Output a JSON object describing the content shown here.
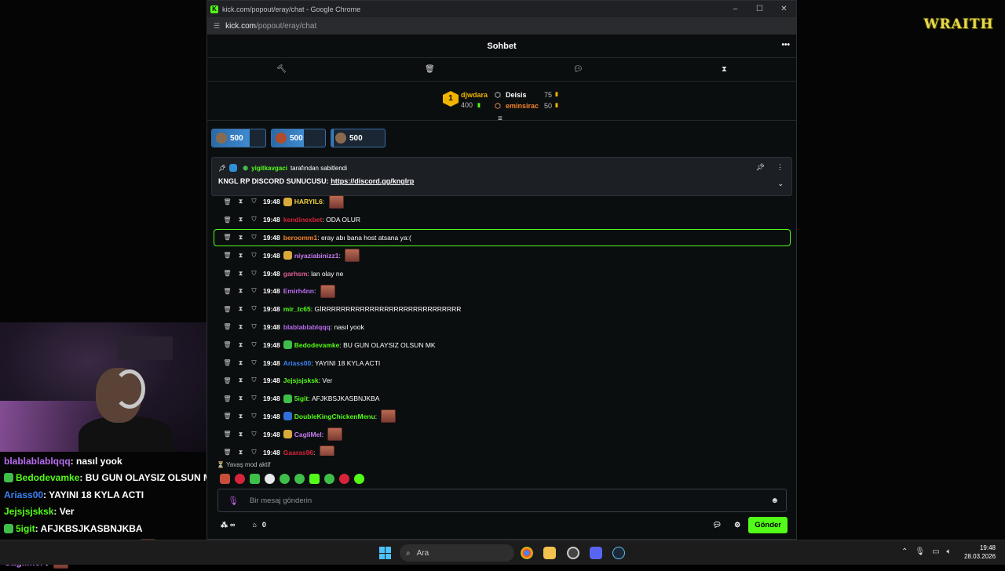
{
  "browser": {
    "window_title": "kick.com/popout/eray/chat - Google Chrome",
    "url_host": "kick.com",
    "url_path": "/popout/eray/chat"
  },
  "chat": {
    "title": "Sohbet",
    "leaderboard": {
      "first": {
        "rank": "1",
        "name": "djwdara",
        "amount": "400"
      },
      "second": {
        "name": "Deisis",
        "amount": "75"
      },
      "third": {
        "name": "eminsirac",
        "amount": "50"
      }
    },
    "gifts": [
      {
        "amount": "500",
        "fill": 0.7
      },
      {
        "amount": "500",
        "fill": 0.6
      },
      {
        "amount": "500",
        "fill": 0.05
      }
    ],
    "pinned": {
      "pinned_by_user": "yigitkavgaci",
      "pinned_by_suffix": "tarafından sabitlendi",
      "message_prefix": "KNGL RP DISCORD SUNUCUSU:",
      "message_link": "https://discord.gg/knglrp"
    },
    "messages": [
      {
        "time": "19:48",
        "user": "HARYIL6",
        "color": "#f2d33a",
        "text": "",
        "emote": true,
        "badge": "#d9a93b"
      },
      {
        "time": "19:48",
        "user": "kendinexbet",
        "color": "#d8243a",
        "text": "ODA OLUR",
        "emote": false,
        "badge": ""
      },
      {
        "time": "19:48",
        "user": "beroomm1",
        "color": "#f2822a",
        "text": "eray abı bana host atsana ya:(",
        "emote": false,
        "badge": "",
        "highlight": true
      },
      {
        "time": "19:48",
        "user": "niyaziabinizz1",
        "color": "#c97bf2",
        "text": "",
        "emote": true,
        "badge": "#d9a93b"
      },
      {
        "time": "19:48",
        "user": "garhsm",
        "color": "#e05d9a",
        "text": "lan olay ne",
        "emote": false,
        "badge": ""
      },
      {
        "time": "19:48",
        "user": "Emirh4nn",
        "color": "#b76cf0",
        "text": "",
        "emote": true,
        "badge": ""
      },
      {
        "time": "19:48",
        "user": "mir_tc65",
        "color": "#53fc18",
        "text": "GİRRRRRRRRRRRRRRRRRRRRRRRRRRRRR",
        "emote": false,
        "badge": ""
      },
      {
        "time": "19:48",
        "user": "blablablablqqq",
        "color": "#b76cf0",
        "text": "nasıl yook",
        "emote": false,
        "badge": ""
      },
      {
        "time": "19:48",
        "user": "Bedodevamke",
        "color": "#53fc18",
        "text": "BU GUN OLAYSIZ OLSUN MK",
        "emote": false,
        "badge": "#3fbf4a"
      },
      {
        "time": "19:48",
        "user": "Ariass00",
        "color": "#3b82f6",
        "text": "YAYINI 18 KYLA ACTI",
        "emote": false,
        "badge": ""
      },
      {
        "time": "19:48",
        "user": "Jejsjsjsksk",
        "color": "#53fc18",
        "text": "Ver",
        "emote": false,
        "badge": ""
      },
      {
        "time": "19:48",
        "user": "5igit",
        "color": "#53fc18",
        "text": "AFJKBSJKASBNJKBA",
        "emote": false,
        "badge": "#3fbf4a"
      },
      {
        "time": "19:48",
        "user": "DoubleKingChickenMenu",
        "color": "#53fc18",
        "text": "",
        "emote": true,
        "badge": "#2f6fd8"
      },
      {
        "time": "19:48",
        "user": "CagliMel",
        "color": "#c97bf2",
        "text": "",
        "emote": true,
        "badge": "#d9a93b"
      },
      {
        "time": "19:48",
        "user": "Gaaras96",
        "color": "#d8243a",
        "text": "",
        "emote": true,
        "badge": ""
      }
    ],
    "slow_mode": "Yavaş mod aktif",
    "input_placeholder": "Bir mesaj gönderin",
    "footer": {
      "infinite": "∞",
      "count": "0",
      "send_label": "Gönder"
    }
  },
  "overlay_chat": [
    {
      "user": "blablablablqqq",
      "color": "#b76cf0",
      "text": ": nasıl yook",
      "emote": false,
      "badge": ""
    },
    {
      "user": "Bedodevamke",
      "color": "#53fc18",
      "text": ": BU GUN OLAYSIZ OLSUN MK",
      "emote": false,
      "badge": "#3fbf4a"
    },
    {
      "user": "Ariass00",
      "color": "#3b82f6",
      "text": ": YAYINI 18 KYLA ACTI",
      "emote": false,
      "badge": ""
    },
    {
      "user": "Jejsjsjsksk",
      "color": "#53fc18",
      "text": ": Ver",
      "emote": false,
      "badge": ""
    },
    {
      "user": "5igit",
      "color": "#53fc18",
      "text": ": AFJKBSJKASBNJKBA",
      "emote": false,
      "badge": "#3fbf4a"
    },
    {
      "user": "DoubleKingChickenMenu",
      "color": "#53fc18",
      "text": " :",
      "emote": true,
      "badge": "#2f6fd8"
    },
    {
      "user": "CagliMel",
      "color": "#c97bf2",
      "text": " :",
      "emote": true,
      "badge": ""
    }
  ],
  "logo_text": "WRAITH",
  "taskbar": {
    "search_label": "Ara",
    "time": "19:48",
    "date": "28.03.2026"
  },
  "colors": {
    "accent": "#53fc18",
    "background": "#0b0e0f"
  }
}
